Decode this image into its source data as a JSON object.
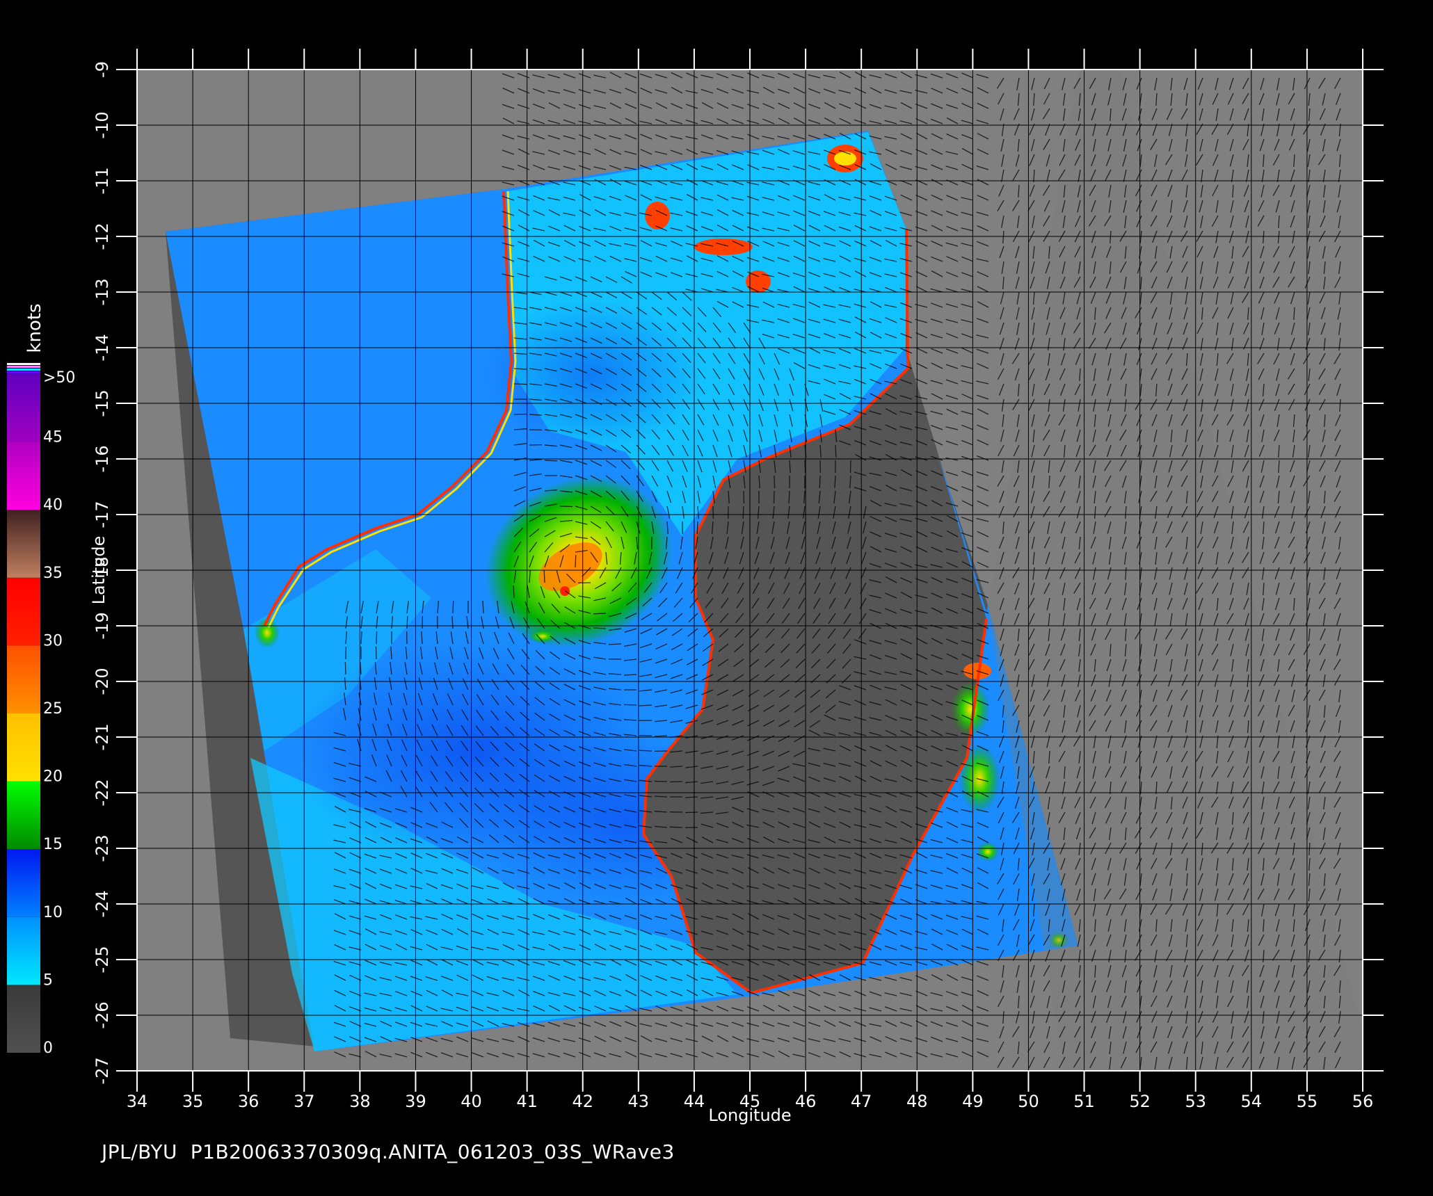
{
  "map": {
    "x_axis": {
      "label": "Longitude",
      "min": 34,
      "max": 56,
      "ticks": [
        "34",
        "35",
        "36",
        "37",
        "38",
        "39",
        "40",
        "41",
        "42",
        "43",
        "44",
        "45",
        "46",
        "47",
        "48",
        "49",
        "50",
        "51",
        "52",
        "53",
        "54",
        "55",
        "56"
      ]
    },
    "y_axis": {
      "label": "Latitude",
      "min": -27,
      "max": -9,
      "ticks": [
        "-9",
        "-10",
        "-11",
        "-12",
        "-13",
        "-14",
        "-15",
        "-16",
        "-17",
        "-18",
        "-19",
        "-20",
        "-21",
        "-22",
        "-23",
        "-24",
        "-25",
        "-26",
        "-27"
      ]
    },
    "grid": true,
    "land": "Madagascar and Mozambique coast (dark gray)",
    "storm_center": {
      "lon": 42.0,
      "lat": -17.9
    }
  },
  "colorbar": {
    "unit_label": "knots",
    "labels": [
      ">50",
      "45",
      "40",
      "35",
      "30",
      "25",
      "20",
      "15",
      "10",
      "5",
      "0"
    ],
    "bands": [
      {
        "from": 0,
        "to": 5,
        "color": "#505050",
        "top": "#3a3a3a"
      },
      {
        "from": 5,
        "to": 10,
        "color": "#00e8ff",
        "top": "#0090ff"
      },
      {
        "from": 10,
        "to": 15,
        "color": "#0080ff",
        "top": "#0018f0"
      },
      {
        "from": 15,
        "to": 20,
        "color": "#008a00",
        "top": "#00ff00"
      },
      {
        "from": 20,
        "to": 25,
        "color": "#ffe000",
        "top": "#ffc000"
      },
      {
        "from": 25,
        "to": 30,
        "color": "#ff9000",
        "top": "#ff5000"
      },
      {
        "from": 30,
        "to": 35,
        "color": "#ff2000",
        "top": "#ff0000"
      },
      {
        "from": 35,
        "to": 40,
        "color": "#c08060",
        "top": "#402020"
      },
      {
        "from": 40,
        "to": 45,
        "color": "#ff00e0",
        "top": "#b000c0"
      },
      {
        "from": 45,
        "to": 50,
        "color": "#a000c0",
        "top": "#6000c0"
      }
    ]
  },
  "footer": {
    "text": "JPL/BYU  P1B20063370309q.ANITA_061203_03S_WRave3"
  }
}
